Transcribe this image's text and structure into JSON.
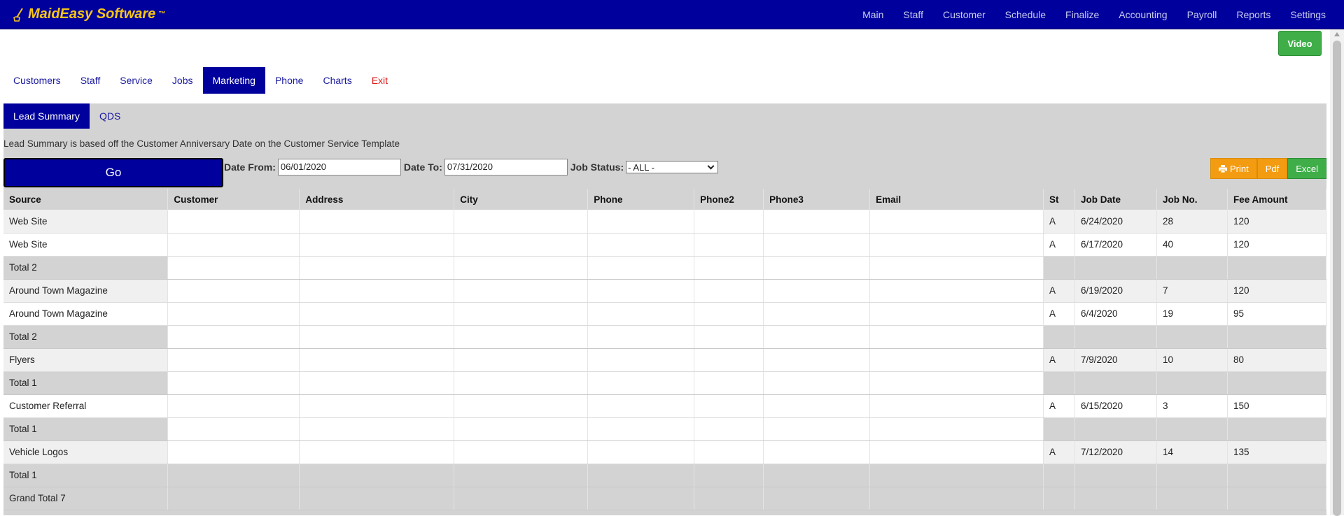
{
  "app": {
    "logo_text": "MaidEasy Software",
    "logo_tm": "™",
    "top_nav": [
      "Main",
      "Staff",
      "Customer",
      "Schedule",
      "Finalize",
      "Accounting",
      "Payroll",
      "Reports",
      "Settings"
    ],
    "video_label": "Video"
  },
  "module_tabs": [
    {
      "label": "Customers"
    },
    {
      "label": "Staff"
    },
    {
      "label": "Service"
    },
    {
      "label": "Jobs"
    },
    {
      "label": "Marketing"
    },
    {
      "label": "Phone"
    },
    {
      "label": "Charts"
    },
    {
      "label": "Exit"
    }
  ],
  "sub_tabs": [
    {
      "label": "Lead Summary"
    },
    {
      "label": "QDS"
    }
  ],
  "report": {
    "note": "Lead Summary is based off the Customer Anniversary Date on the Customer Service Template",
    "go_label": "Go",
    "date_from_label": "Date From:",
    "date_from_value": "06/01/2020",
    "date_to_label": "Date To:",
    "date_to_value": "07/31/2020",
    "job_status_label": "Job Status:",
    "job_status_value": "- ALL -",
    "print_label": "Print",
    "pdf_label": "Pdf",
    "excel_label": "Excel"
  },
  "table": {
    "columns": [
      "Source",
      "Customer",
      "Address",
      "City",
      "Phone",
      "Phone2",
      "Phone3",
      "Email",
      "St",
      "Job Date",
      "Job No.",
      "Fee Amount"
    ],
    "rows": [
      {
        "type": "data",
        "source": "Web Site",
        "st": "A",
        "job_date": "6/24/2020",
        "job_no": "28",
        "fee": "120"
      },
      {
        "type": "data",
        "source": "Web Site",
        "st": "A",
        "job_date": "6/17/2020",
        "job_no": "40",
        "fee": "120"
      },
      {
        "type": "total",
        "source": "Total 2"
      },
      {
        "type": "data",
        "source": "Around Town Magazine",
        "st": "A",
        "job_date": "6/19/2020",
        "job_no": "7",
        "fee": "120"
      },
      {
        "type": "data",
        "source": "Around Town Magazine",
        "st": "A",
        "job_date": "6/4/2020",
        "job_no": "19",
        "fee": "95"
      },
      {
        "type": "total",
        "source": "Total 2"
      },
      {
        "type": "data",
        "source": "Flyers",
        "st": "A",
        "job_date": "7/9/2020",
        "job_no": "10",
        "fee": "80"
      },
      {
        "type": "total",
        "source": "Total 1"
      },
      {
        "type": "data",
        "source": "Customer Referral",
        "st": "A",
        "job_date": "6/15/2020",
        "job_no": "3",
        "fee": "150"
      },
      {
        "type": "total",
        "source": "Total 1"
      },
      {
        "type": "data",
        "source": "Vehicle Logos",
        "st": "A",
        "job_date": "7/12/2020",
        "job_no": "14",
        "fee": "135"
      },
      {
        "type": "total",
        "source": "Total 1"
      },
      {
        "type": "grand",
        "source": "Grand Total 7"
      }
    ]
  }
}
